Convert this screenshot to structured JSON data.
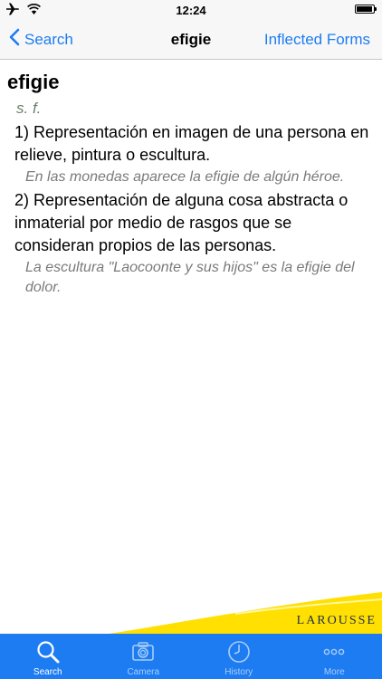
{
  "status_bar": {
    "time": "12:24",
    "battery_level": 0.92
  },
  "nav": {
    "back_label": "Search",
    "title": "efigie",
    "right_label": "Inflected Forms"
  },
  "entry": {
    "headword": "efigie",
    "part_of_speech": "s. f.",
    "senses": [
      {
        "definition": "1) Representación en imagen de una persona en relieve, pintura o escultura.",
        "example": "En las monedas aparece la efigie de algún héroe."
      },
      {
        "definition": "2) Representación de alguna cosa abstracta o inmaterial por medio de rasgos que se consideran propios de las personas.",
        "example": "La escultura \"Laocoonte y sus hijos\" es la efigie del dolor."
      }
    ]
  },
  "banner": {
    "brand": "LAROUSSE",
    "color": "#ffe000"
  },
  "tabs": [
    {
      "label": "Search",
      "icon": "search-icon",
      "active": true
    },
    {
      "label": "Camera",
      "icon": "camera-icon",
      "active": false
    },
    {
      "label": "History",
      "icon": "clock-icon",
      "active": false
    },
    {
      "label": "More",
      "icon": "more-icon",
      "active": false
    }
  ],
  "colors": {
    "accent": "#1d7cf2",
    "tab_inactive": "#a9cdf8"
  }
}
